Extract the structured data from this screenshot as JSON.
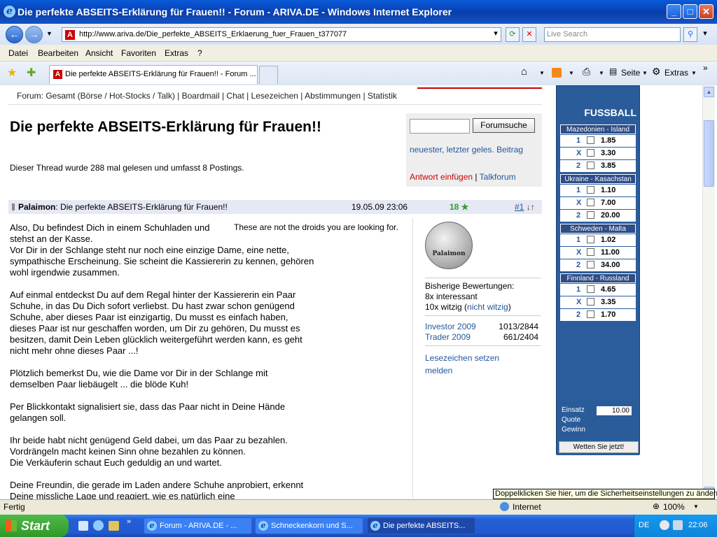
{
  "window": {
    "title": "Die perfekte ABSEITS-Erklärung für Frauen!! - Forum - ARIVA.DE - Windows Internet Explorer",
    "minimize": "_",
    "maximize": "□",
    "close": "✕"
  },
  "addressbar": {
    "url": "http://www.ariva.de/Die_perfekte_ABSEITS_Erklaerung_fuer_Frauen_t377077",
    "search_placeholder": "Live Search"
  },
  "menu": [
    "Datei",
    "Bearbeiten",
    "Ansicht",
    "Favoriten",
    "Extras",
    "?"
  ],
  "tabbar": {
    "tab_title": "Die perfekte ABSEITS-Erklärung für Frauen!! - Forum ...",
    "seite": "Seite",
    "extras": "Extras"
  },
  "page": {
    "topnav": "Forum: Gesamt (Börse / Hot-Stocks / Talk) | Boardmail | Chat | Lesezeichen | Abstimmungen | Statistik",
    "title": "Die perfekte ABSEITS-Erklärung für Frauen!!",
    "thread_info": "Dieser Thread wurde 288 mal gelesen und umfasst 8 Postings.",
    "search_button": "Forumsuche",
    "links_line": "neuester, letzter geles. Beitrag",
    "answer": "Antwort einfügen",
    "separator": " | ",
    "talkforum": "Talkforum",
    "post": {
      "user": "Palaimon",
      "subject": ": Die perfekte ABSEITS-Erklärung für Frauen!!",
      "date": "19.05.09 23:06",
      "stars": "18 ★",
      "number": "#1",
      "arrows": " ↓↑",
      "body": "Also, Du befindest Dich in einem Schuhladen und\nstehst an der Kasse.\nVor Dir in der Schlange steht nur noch eine einzige Dame, eine nette,\nsympathische Erscheinung. Sie scheint die Kassiererin zu kennen, gehören\nwohl irgendwie zusammen.\n\nAuf einmal entdeckst Du auf dem Regal hinter der Kassiererin ein Paar\nSchuhe, in das Du Dich sofort verliebst. Du hast zwar schon genügend\nSchuhe, aber dieses Paar ist einzigartig, Du musst es einfach haben,\ndieses Paar ist nur geschaffen worden, um Dir zu gehören, Du musst es\nbesitzen, damit Dein Leben glücklich weitergeführt werden kann, es geht\nnicht mehr ohne dieses Paar ...!\n\nPlötzlich bemerkst Du, wie die Dame vor Dir in der Schlange mit\ndemselben Paar liebäugelt ... die blöde Kuh!\n\nPer Blickkontakt signalisiert sie, dass das Paar nicht in Deine Hände\ngelangen soll.\n\nIhr beide habt nicht genügend Geld dabei, um das Paar zu bezahlen.\nVordrängeln macht keinen Sinn ohne bezahlen zu können.\nDie Verkäuferin schaut Euch geduldig an und wartet.\n\nDeine Freundin, die gerade im Laden andere Schuhe anprobiert, erkennt\nDeine missliche Lage und reagiert, wie es natürlich eine",
      "signature": "These are not the droids you are looking for."
    },
    "sidebar": {
      "medal_text": "Palaimon",
      "ratings_title": "Bisherige Bewertungen:",
      "rating1": "8x interessant",
      "rating2_prefix": "10x witzig (",
      "rating2_link": "nicht witzig",
      "rating2_suffix": ")",
      "investor_label": "Investor 2009",
      "investor_value": "1013/2844",
      "trader_label": "Trader 2009",
      "trader_value": "661/2404",
      "bookmark": "Lesezeichen setzen",
      "report": "melden"
    }
  },
  "ad": {
    "header": "FUSSBALL",
    "matches": [
      {
        "name": "Mazedonien - Island",
        "odds": [
          "1.85",
          "3.30",
          "3.85"
        ]
      },
      {
        "name": "Ukraine - Kasachstan",
        "odds": [
          "1.10",
          "7.00",
          "20.00"
        ]
      },
      {
        "name": "Schweden - Malta",
        "odds": [
          "1.02",
          "11.00",
          "34.00"
        ]
      },
      {
        "name": "Finnland - Russland",
        "odds": [
          "4.65",
          "3.35",
          "1.70"
        ]
      }
    ],
    "keys": [
      "1",
      "X",
      "2"
    ],
    "einsatz_label": "Einsatz",
    "einsatz_value": "10.00",
    "quote_label": "Quote",
    "gewinn_label": "Gewinn",
    "bet_button": "Wetten Sie jetzt!"
  },
  "status": {
    "text": "Fertig",
    "zone": "Internet",
    "zoom": "100%",
    "tooltip": "Doppelklicken Sie hier, um die Sicherheitseinstellungen zu ändern."
  },
  "taskbar": {
    "start": "Start",
    "tasks": [
      "Forum - ARIVA.DE - ...",
      "Schneckenkorn und S...",
      "Die perfekte ABSEITS..."
    ],
    "lang": "DE",
    "time": "22:06"
  }
}
